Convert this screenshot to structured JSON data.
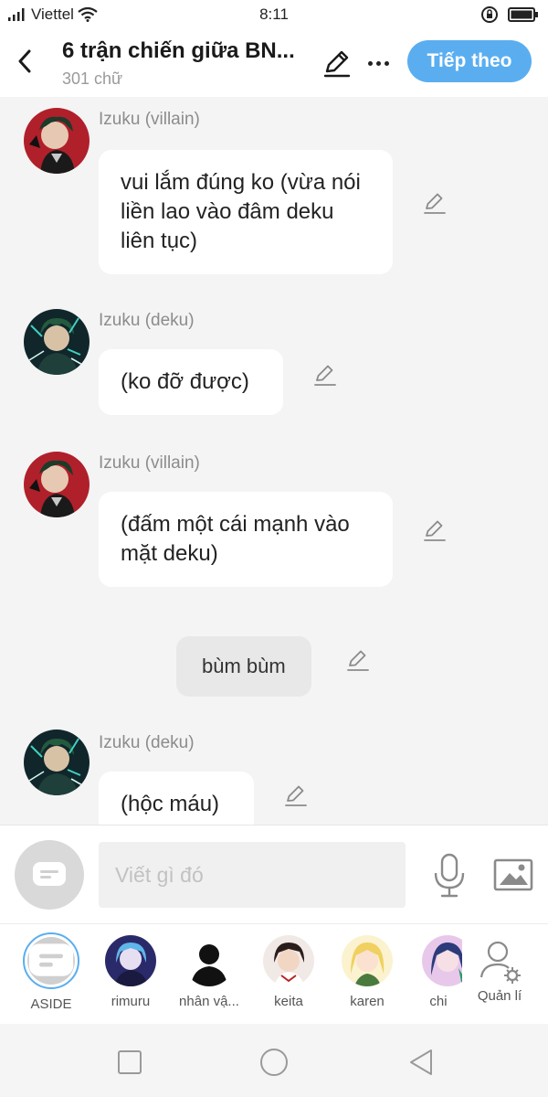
{
  "status_bar": {
    "carrier": "Viettel",
    "time": "8:11"
  },
  "header": {
    "title": "6 trận chiến giữa BN...",
    "subtitle": "301 chữ",
    "next_button": "Tiếp theo"
  },
  "messages": [
    {
      "type": "character",
      "sender": "Izuku (villain)",
      "text": "vui lắm đúng ko (vừa nói liền lao vào đâm deku liên tục)",
      "avatar": "villain"
    },
    {
      "type": "character",
      "sender": "Izuku (deku)",
      "text": "(ko đỡ được)",
      "avatar": "deku"
    },
    {
      "type": "character",
      "sender": "Izuku (villain)",
      "text": "(đấm một cái mạnh vào mặt deku)",
      "avatar": "villain"
    },
    {
      "type": "aside",
      "text": "bùm bùm"
    },
    {
      "type": "character",
      "sender": "Izuku (deku)",
      "text": "(hộc máu)",
      "avatar": "deku"
    }
  ],
  "input": {
    "placeholder": "Viết gì đó"
  },
  "characters": [
    {
      "name": "ASIDE",
      "selected": true
    },
    {
      "name": "rimuru",
      "selected": false
    },
    {
      "name": "nhân vậ...",
      "selected": false
    },
    {
      "name": "keita",
      "selected": false
    },
    {
      "name": "karen",
      "selected": false
    },
    {
      "name": "chi",
      "selected": false
    }
  ],
  "manage_label": "Quản lí",
  "colors": {
    "accent": "#5aaef0",
    "background": "#f4f4f4",
    "bubble": "#ffffff",
    "aside_bubble": "#e8e8e8"
  }
}
